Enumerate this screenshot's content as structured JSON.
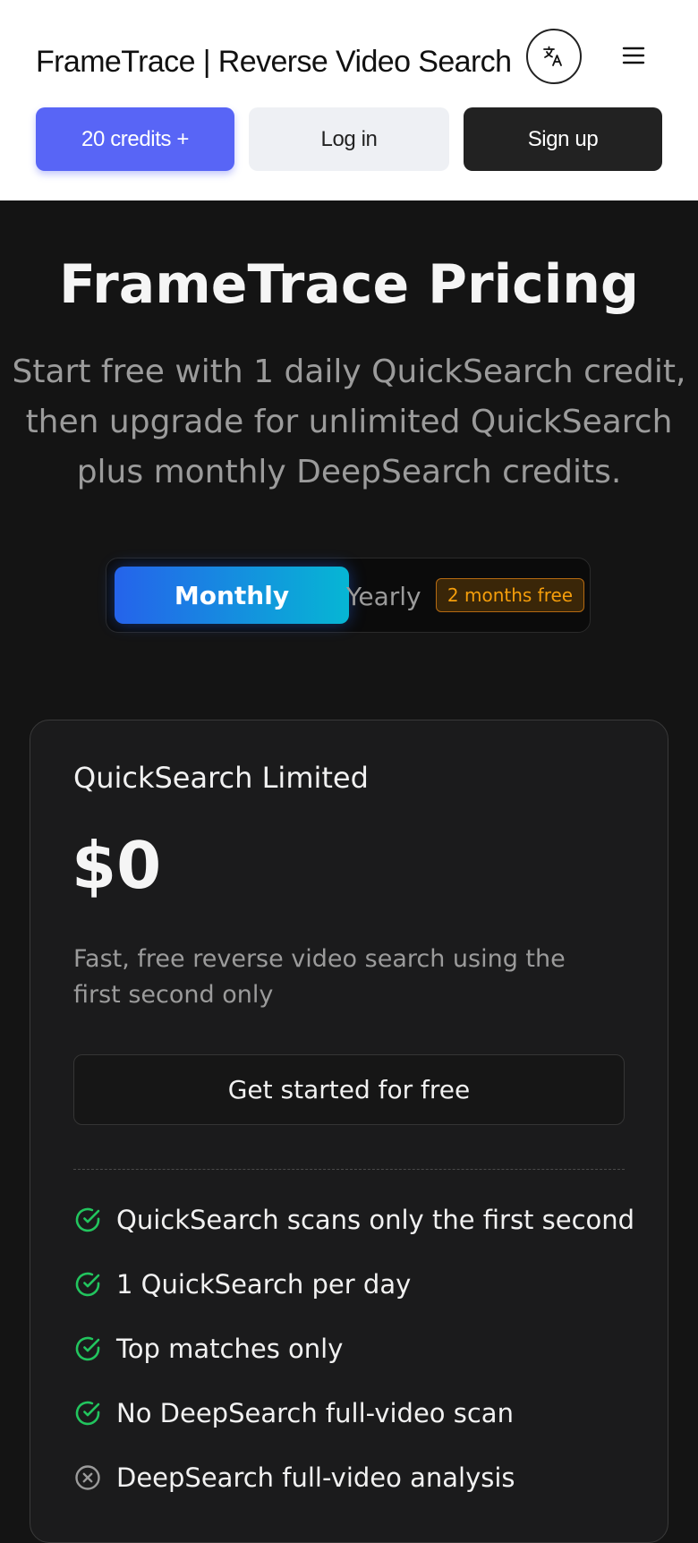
{
  "header": {
    "brand": "FrameTrace | Reverse Video Search",
    "language_icon": "translate-icon",
    "menu_icon": "hamburger-menu-icon",
    "credits_label": "20 credits +",
    "login_label": "Log in",
    "signup_label": "Sign up"
  },
  "hero": {
    "title": "FrameTrace Pricing",
    "subtitle": "Start free with 1 daily QuickSearch credit, then upgrade for unlimited QuickSearch plus monthly DeepSearch credits."
  },
  "billing_toggle": {
    "monthly_label": "Monthly",
    "yearly_label": "Yearly",
    "yearly_badge": "2 months free",
    "selected": "Monthly"
  },
  "plan": {
    "name": "QuickSearch Limited",
    "price": "$0",
    "description": "Fast, free reverse video search using the first second only",
    "cta_label": "Get started for free",
    "features": [
      {
        "text": "QuickSearch scans only the first second",
        "included": true,
        "icon": "check-circle-icon"
      },
      {
        "text": "1 QuickSearch per day",
        "included": true,
        "icon": "check-circle-icon"
      },
      {
        "text": "Top matches only",
        "included": true,
        "icon": "check-circle-icon"
      },
      {
        "text": "No DeepSearch full-video scan",
        "included": true,
        "icon": "check-circle-icon"
      },
      {
        "text": "DeepSearch full-video analysis",
        "included": false,
        "icon": "x-circle-icon"
      }
    ]
  },
  "colors": {
    "accent": "#5865f6",
    "background": "#141414",
    "card": "#1b1b1c",
    "check_green": "#22c55e",
    "badge_orange": "#f59e0b",
    "toggle_gradient_start": "#2563eb",
    "toggle_gradient_end": "#06b6d4"
  }
}
